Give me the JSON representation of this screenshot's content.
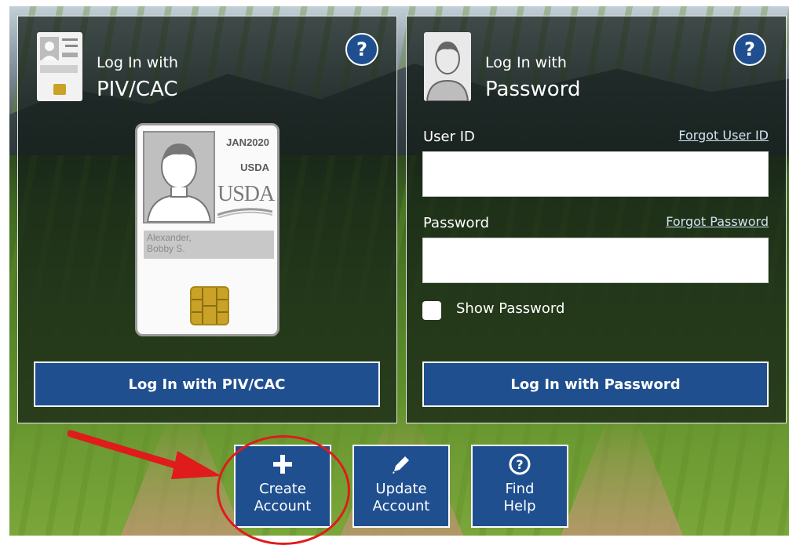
{
  "piv_panel": {
    "title_small": "Log In with",
    "title_big": "PIV/CAC",
    "help_label": "?",
    "card": {
      "date": "JAN2020",
      "agency": "USDA",
      "logo_text": "USDA",
      "name_line1": "Alexander,",
      "name_line2": "Bobby S."
    },
    "button_label": "Log In with PIV/CAC"
  },
  "password_panel": {
    "title_small": "Log In with",
    "title_big": "Password",
    "help_label": "?",
    "user_id_label": "User ID",
    "forgot_user_id": "Forgot User ID",
    "user_id_value": "",
    "password_label": "Password",
    "forgot_password": "Forgot Password",
    "password_value": "",
    "show_password_label": "Show Password",
    "show_password_checked": false,
    "button_label": "Log In with Password"
  },
  "tiles": [
    {
      "icon": "plus-icon",
      "line1": "Create",
      "line2": "Account",
      "highlighted": true
    },
    {
      "icon": "pencil-icon",
      "line1": "Update",
      "line2": "Account",
      "highlighted": false
    },
    {
      "icon": "question-circle-icon",
      "line1": "Find",
      "line2": "Help",
      "highlighted": false
    }
  ],
  "colors": {
    "primary": "#1f4f8f",
    "annotation": "#e01b1b",
    "chip": "#c9a227"
  }
}
